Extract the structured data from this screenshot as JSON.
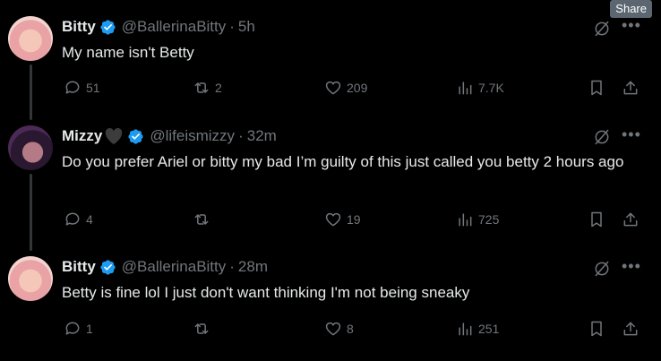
{
  "share_tooltip": "Share",
  "tweets": [
    {
      "name": "Bitty",
      "handle": "@BallerinaBitty",
      "sep": "·",
      "time": "5h",
      "text": "My name isn't Betty",
      "replies": "51",
      "reposts": "2",
      "likes": "209",
      "views": "7.7K"
    },
    {
      "name": "Mizzy",
      "handle": "@lifeismizzy",
      "sep": "·",
      "time": "32m",
      "text": "Do you prefer Ariel or bitty my bad I’m guilty of this just called you betty 2 hours ago",
      "replies": "4",
      "reposts": "",
      "likes": "19",
      "views": "725"
    },
    {
      "name": "Bitty",
      "handle": "@BallerinaBitty",
      "sep": "·",
      "time": "28m",
      "text": "Betty is fine lol I just don't want thinking I'm not being sneaky",
      "replies": "1",
      "reposts": "",
      "likes": "8",
      "views": "251"
    }
  ],
  "colors": {
    "background": "#000000",
    "text": "#e7e9ea",
    "muted": "#71767b",
    "verified": "#1d9bf0"
  },
  "icons": [
    "reply-icon",
    "repost-icon",
    "like-icon",
    "views-icon",
    "bookmark-icon",
    "share-icon",
    "grok-icon",
    "more-icon",
    "verified-icon",
    "black-heart-icon"
  ]
}
